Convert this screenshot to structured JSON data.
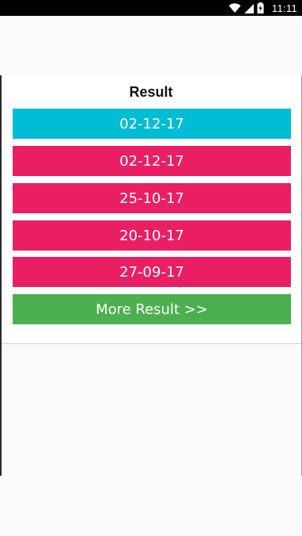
{
  "status_bar": {
    "time": "11:11",
    "icons": [
      "wifi-icon",
      "signal-icon",
      "battery-charging-icon"
    ]
  },
  "main": {
    "title": "Result",
    "results": [
      {
        "label": "02-12-17",
        "color": "#00bcd4"
      },
      {
        "label": "02-12-17",
        "color": "#e91e63"
      },
      {
        "label": "25-10-17",
        "color": "#e91e63"
      },
      {
        "label": "20-10-17",
        "color": "#e91e63"
      },
      {
        "label": "27-09-17",
        "color": "#e91e63"
      }
    ],
    "more_label": "More Result >>",
    "more_color": "#4caf50"
  }
}
